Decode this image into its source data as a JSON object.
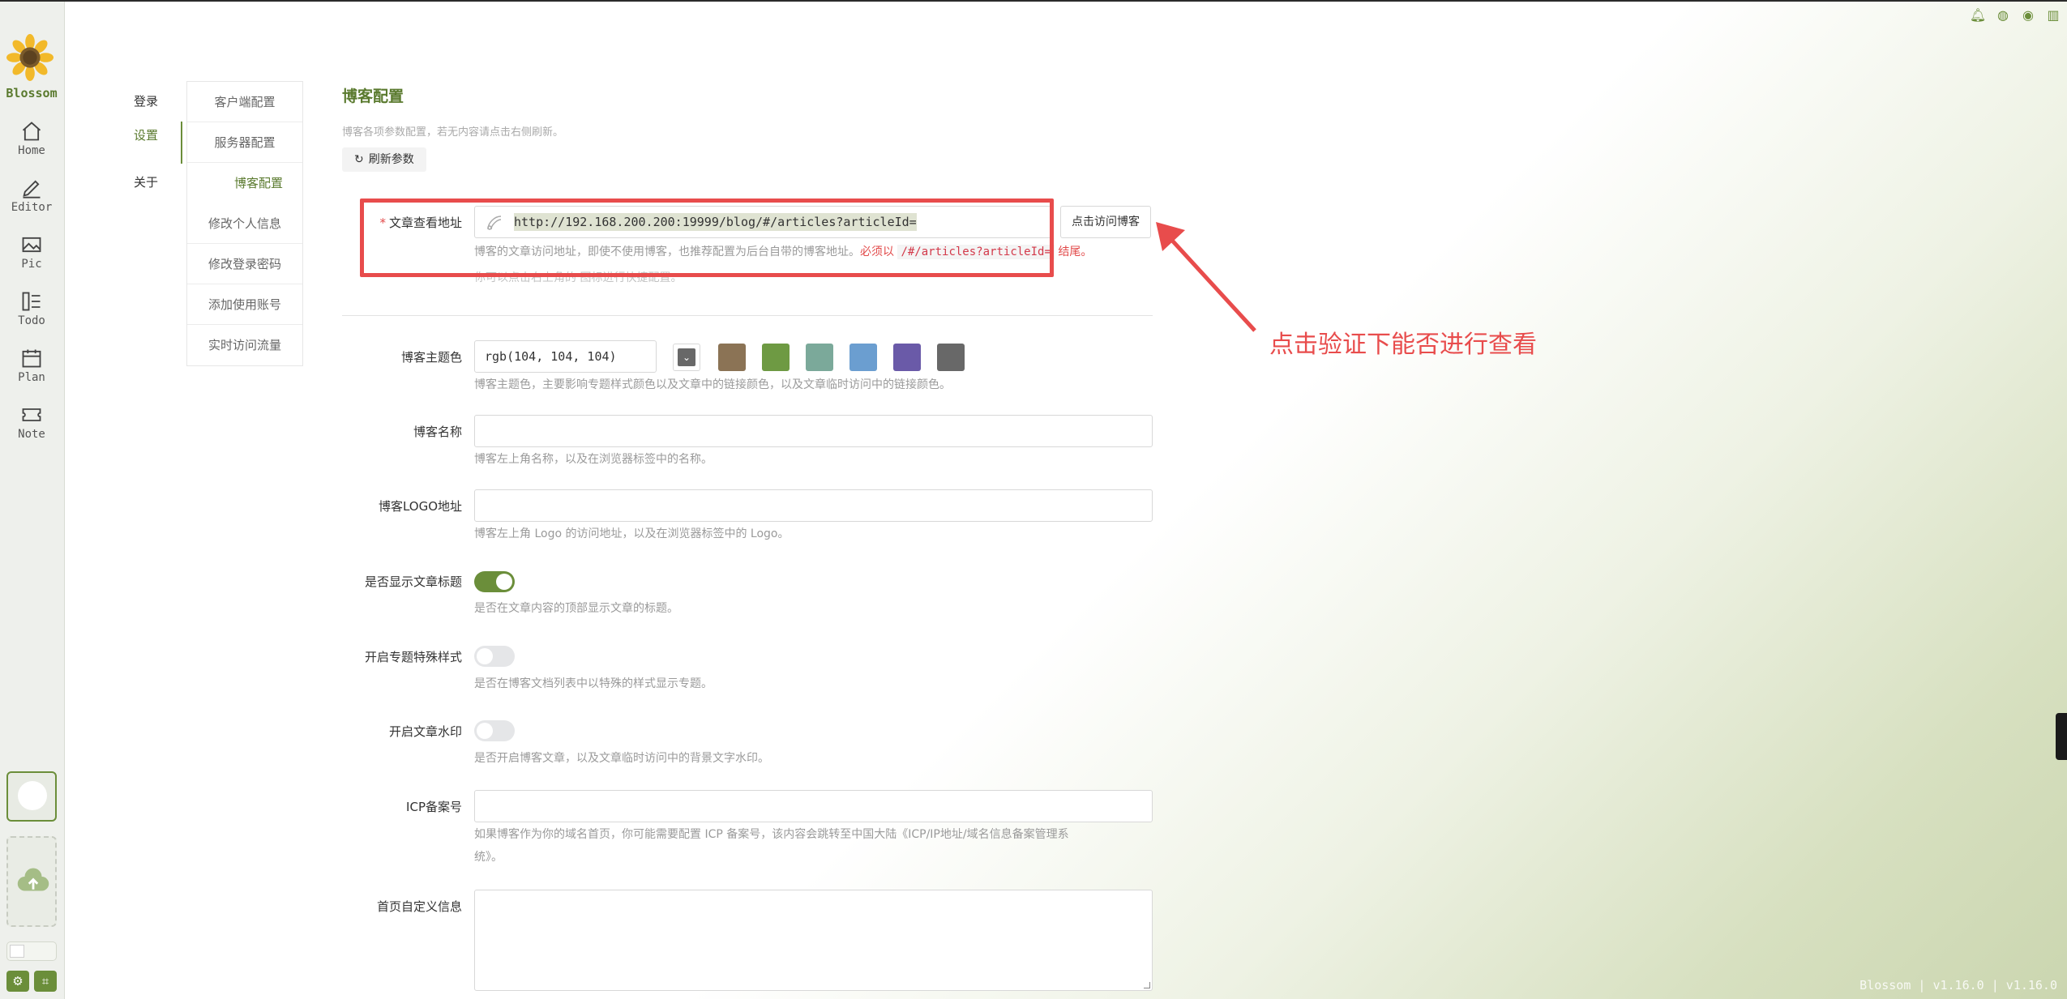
{
  "app": {
    "name": "Blossom",
    "version_text": "Blossom | v1.16.0 | v1.16.0"
  },
  "rail": {
    "items": [
      {
        "label": "Home",
        "icon": "home-icon"
      },
      {
        "label": "Editor",
        "icon": "pen-icon"
      },
      {
        "label": "Pic",
        "icon": "image-icon"
      },
      {
        "label": "Todo",
        "icon": "checklist-icon"
      },
      {
        "label": "Plan",
        "icon": "calendar-icon"
      },
      {
        "label": "Note",
        "icon": "ticket-icon"
      }
    ]
  },
  "settings_nav": {
    "items": [
      {
        "label": "登录",
        "active": false
      },
      {
        "label": "设置",
        "active": true
      },
      {
        "label": "关于",
        "active": false
      }
    ]
  },
  "sub_nav": {
    "items": [
      {
        "label": "客户端配置",
        "active": false
      },
      {
        "label": "服务器配置",
        "active": false
      },
      {
        "label": "博客配置",
        "active": true
      },
      {
        "label": "修改个人信息",
        "active": false
      },
      {
        "label": "修改登录密码",
        "active": false
      },
      {
        "label": "添加使用账号",
        "active": false
      },
      {
        "label": "实时访问流量",
        "active": false
      }
    ]
  },
  "page": {
    "title": "博客配置",
    "description": "博客各项参数配置，若无内容请点击右侧刷新。",
    "refresh_label": "刷新参数"
  },
  "form": {
    "article_url": {
      "label": "文章查看地址",
      "value": "http://192.168.200.200:19999/blog/#/articles?articleId=",
      "visit_button": "点击访问博客",
      "help_prefix": "博客的文章访问地址，即使不使用博客，也推荐配置为后台自带的博客地址。",
      "help_warn_prefix": "必须以",
      "help_code": "/#/articles?articleId=",
      "help_warn_suffix": "结尾。",
      "help_line2": "你可以点击右上角的   图标进行快捷配置。"
    },
    "theme_color": {
      "label": "博客主题色",
      "value": "rgb(104, 104, 104)",
      "help": "博客主题色，主要影响专题样式颜色以及文章中的链接颜色，以及文章临时访问中的链接颜色。",
      "swatches": [
        "#8b7355",
        "#6e9a43",
        "#7ba99a",
        "#6b9ed0",
        "#6a5aa8",
        "#686868"
      ]
    },
    "blog_name": {
      "label": "博客名称",
      "value": "",
      "help": "博客左上角名称，以及在浏览器标签中的名称。"
    },
    "blog_logo": {
      "label": "博客LOGO地址",
      "value": "",
      "help": "博客左上角 Logo 的访问地址，以及在浏览器标签中的 Logo。"
    },
    "show_title": {
      "label": "是否显示文章标题",
      "on": true,
      "help": "是否在文章内容的顶部显示文章的标题。"
    },
    "special_style": {
      "label": "开启专题特殊样式",
      "on": false,
      "help": "是否在博客文档列表中以特殊的样式显示专题。"
    },
    "watermark": {
      "label": "开启文章水印",
      "on": false,
      "help": "是否开启博客文章，以及文章临时访问中的背景文字水印。"
    },
    "icp": {
      "label": "ICP备案号",
      "value": "",
      "help_line1": "如果博客作为你的域名首页，你可能需要配置 ICP 备案号，该内容会跳转至中国大陆《ICP/IP地址/域名信息备案管理系",
      "help_line2": "统》。"
    },
    "home_info": {
      "label": "首页自定义信息",
      "value": ""
    }
  },
  "annotation": {
    "note": "点击验证下能否进行查看",
    "color": "#e84c4c"
  },
  "colors": {
    "accent": "#6b8e3a",
    "accent_text": "#5a7a2e"
  }
}
